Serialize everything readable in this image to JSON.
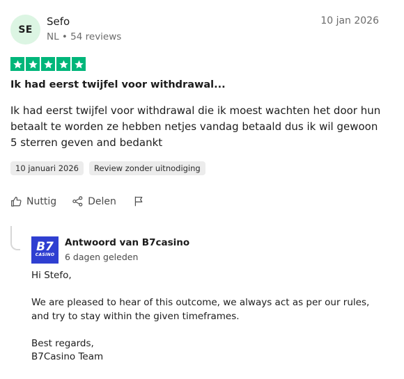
{
  "reviewer": {
    "initials": "SE",
    "name": "Sefo",
    "meta": "NL • 54 reviews",
    "date_short": "10 jan 2026"
  },
  "rating": {
    "stars": 5,
    "max": 5,
    "color": "#00b67a"
  },
  "review": {
    "title": "Ik had eerst twijfel voor withdrawal...",
    "body": "Ik had eerst twijfel voor withdrawal die ik moest wachten het door hun betaalt te worden ze hebben netjes vandag betaald dus ik wil gewoon 5 sterren geven and bedankt",
    "tags": [
      "10 januari 2026",
      "Review zonder uitnodiging"
    ]
  },
  "actions": {
    "helpful_label": "Nuttig",
    "share_label": "Delen",
    "flag_icon": "flag-icon"
  },
  "reply": {
    "logo_mark": "B7",
    "logo_word": "CASINO",
    "author": "Antwoord van B7casino",
    "date": "6 dagen geleden",
    "greeting": "Hi Stefo,",
    "paragraph": "We are pleased to hear of this outcome, we always act as per our rules, and try to stay within the given timeframes.",
    "closing": "Best regards,",
    "signature": "B7Casino Team",
    "brand_color": "#2f3fd1"
  }
}
